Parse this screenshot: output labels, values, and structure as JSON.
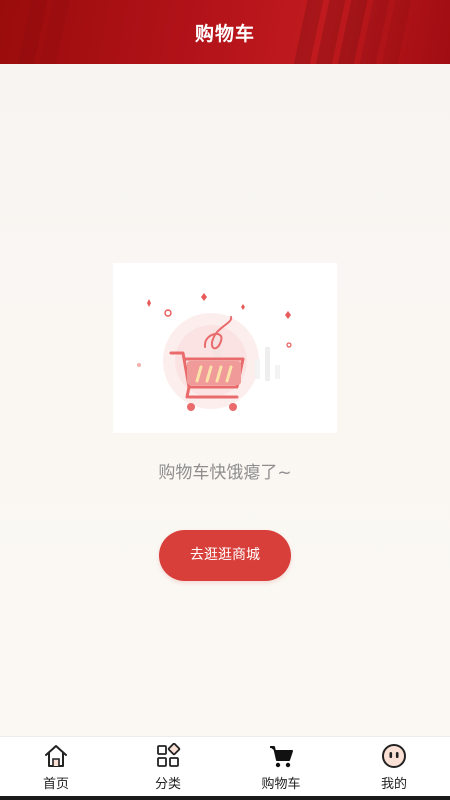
{
  "header": {
    "title": "购物车"
  },
  "empty_state": {
    "message": "购物车快饿瘪了~",
    "button_label": "去逛逛商城"
  },
  "tabbar": {
    "items": [
      {
        "label": "首页",
        "icon": "home-icon"
      },
      {
        "label": "分类",
        "icon": "category-icon"
      },
      {
        "label": "购物车",
        "icon": "cart-icon"
      },
      {
        "label": "我的",
        "icon": "profile-icon"
      }
    ]
  },
  "colors": {
    "header_red": "#b3131a",
    "button_red": "#d83f3a",
    "illustration_pink": "#f1a4a4",
    "illustration_yellow": "#f8d7a5"
  }
}
